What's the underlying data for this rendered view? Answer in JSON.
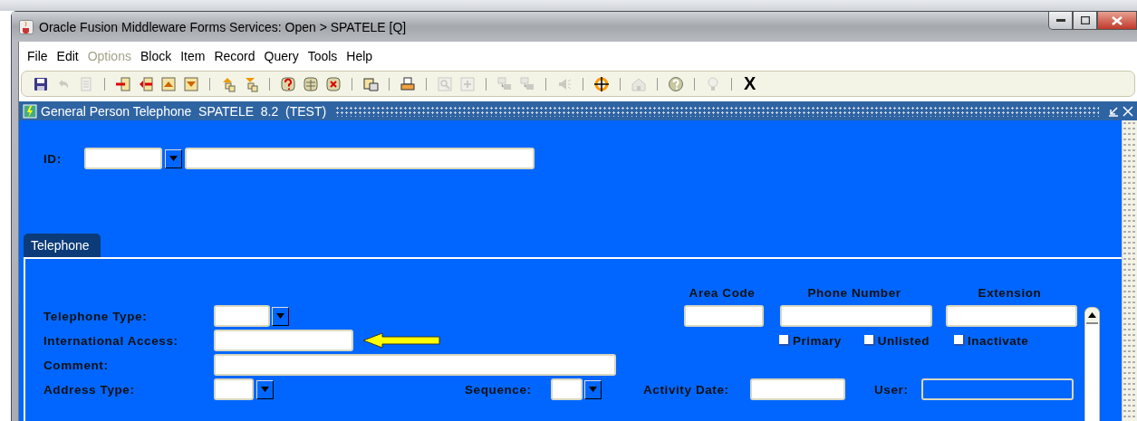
{
  "window": {
    "title": "Oracle Fusion Middleware Forms Services:  Open > SPATELE [Q]"
  },
  "menu": [
    {
      "label": "File",
      "disabled": false
    },
    {
      "label": "Edit",
      "disabled": false
    },
    {
      "label": "Options",
      "disabled": true
    },
    {
      "label": "Block",
      "disabled": false
    },
    {
      "label": "Item",
      "disabled": false
    },
    {
      "label": "Record",
      "disabled": false
    },
    {
      "label": "Query",
      "disabled": false
    },
    {
      "label": "Tools",
      "disabled": false
    },
    {
      "label": "Help",
      "disabled": false
    }
  ],
  "toolbar": {
    "groups": [
      [
        {
          "kind": "save",
          "disabled": false
        },
        {
          "kind": "undo",
          "disabled": true
        },
        {
          "kind": "page",
          "disabled": true
        }
      ],
      [
        {
          "kind": "insert",
          "disabled": false
        },
        {
          "kind": "remove",
          "disabled": false
        },
        {
          "kind": "up",
          "disabled": false
        },
        {
          "kind": "down",
          "disabled": false
        }
      ],
      [
        {
          "kind": "enterquery",
          "disabled": false
        },
        {
          "kind": "execquery",
          "disabled": false
        }
      ],
      [
        {
          "kind": "dbhelp",
          "disabled": false
        },
        {
          "kind": "db",
          "disabled": false
        },
        {
          "kind": "dbx",
          "disabled": false
        }
      ],
      [
        {
          "kind": "copy",
          "disabled": false
        }
      ],
      [
        {
          "kind": "print",
          "disabled": false
        }
      ],
      [
        {
          "kind": "search",
          "disabled": true
        },
        {
          "kind": "plus",
          "disabled": true
        }
      ],
      [
        {
          "kind": "blocks",
          "disabled": true
        },
        {
          "kind": "blocks",
          "disabled": true
        }
      ],
      [
        {
          "kind": "speaker",
          "disabled": true
        }
      ],
      [
        {
          "kind": "target",
          "disabled": false
        }
      ],
      [
        {
          "kind": "house",
          "disabled": true
        }
      ],
      [
        {
          "kind": "help",
          "disabled": false
        }
      ],
      [
        {
          "kind": "bulb",
          "disabled": true
        }
      ]
    ],
    "exit": "X"
  },
  "form": {
    "title": "General Person Telephone  SPATELE  8.2  (TEST)",
    "id_label": "ID:",
    "tabs": [
      {
        "label": "Telephone",
        "selected": true
      }
    ],
    "fields": {
      "telephone_type": "Telephone Type:",
      "international_access": "International Access:",
      "comment": "Comment:",
      "address_type": "Address Type:",
      "sequence": "Sequence:",
      "activity_date": "Activity Date:",
      "user": "User:"
    },
    "columns": [
      "Area Code",
      "Phone Number",
      "Extension"
    ],
    "checkboxes": [
      {
        "label": "Primary",
        "checked": false
      },
      {
        "label": "Unlisted",
        "checked": false
      },
      {
        "label": "Inactivate",
        "checked": false
      }
    ]
  }
}
